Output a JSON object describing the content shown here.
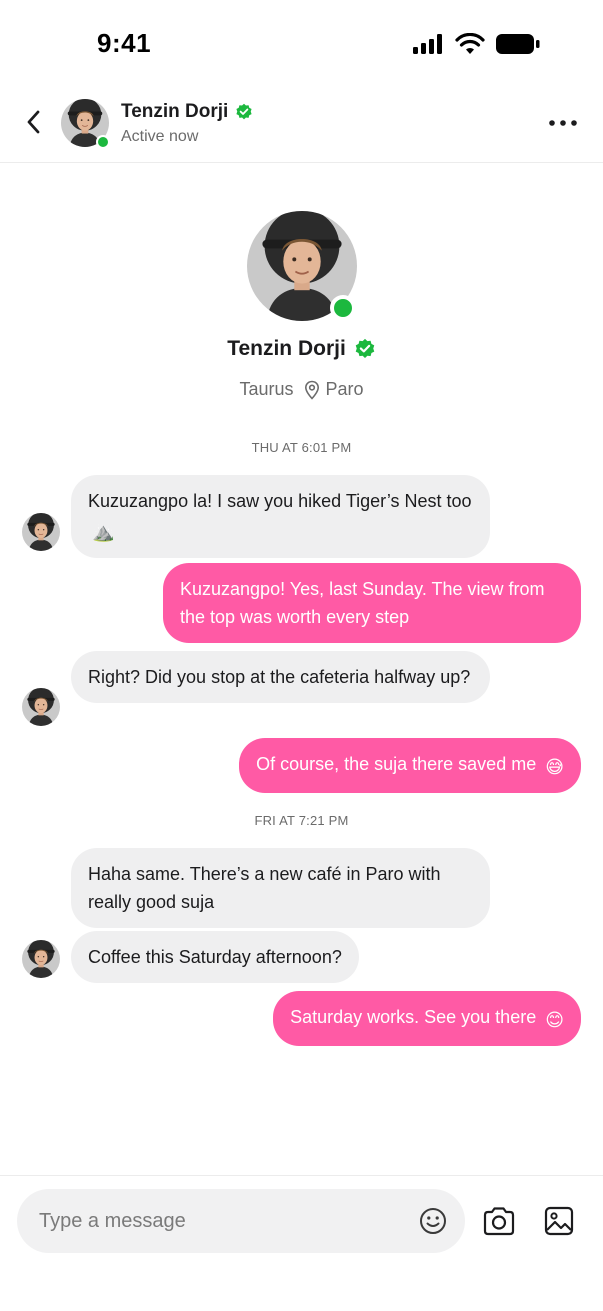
{
  "status_bar": {
    "time": "9:41"
  },
  "header": {
    "name": "Tenzin Dorji",
    "status": "Active now",
    "back_icon": "chevron-left-icon",
    "more_icon": "more-horizontal-icon",
    "verified_icon": "verified-badge-icon"
  },
  "profile": {
    "name": "Tenzin Dorji",
    "zodiac": "Taurus",
    "location": "Paro",
    "location_icon": "location-pin-icon"
  },
  "conversation": {
    "day1": "THU AT 6:01 PM",
    "day2": "FRI AT 7:21 PM",
    "messages": [
      {
        "from": "them",
        "text": "Kuzuzangpo la! I saw you hiked Tiger’s Nest too",
        "emoji": "⛰️"
      },
      {
        "from": "me",
        "text": "Kuzuzangpo! Yes, last Sunday. The view from the top was worth every step"
      },
      {
        "from": "them",
        "text": "Right? Did you stop at the cafeteria halfway up?"
      },
      {
        "from": "me",
        "text": "Of course, the suja there saved me",
        "emoji": "😅"
      },
      {
        "from": "them",
        "text": "Haha same. There’s a new café in Paro with really good suja"
      },
      {
        "from": "them",
        "text": "Coffee this Saturday afternoon?"
      },
      {
        "from": "me",
        "text": "Saturday works. See you there",
        "emoji": "😊"
      }
    ]
  },
  "composer": {
    "placeholder": "Type a message",
    "emoji_icon": "smiley-icon",
    "camera_icon": "camera-icon",
    "gallery_icon": "image-icon"
  },
  "colors": {
    "outgoing_bubble": "#ff5aa5",
    "incoming_bubble": "#efeff0",
    "online": "#1cb83e",
    "verified": "#1cb83e"
  }
}
